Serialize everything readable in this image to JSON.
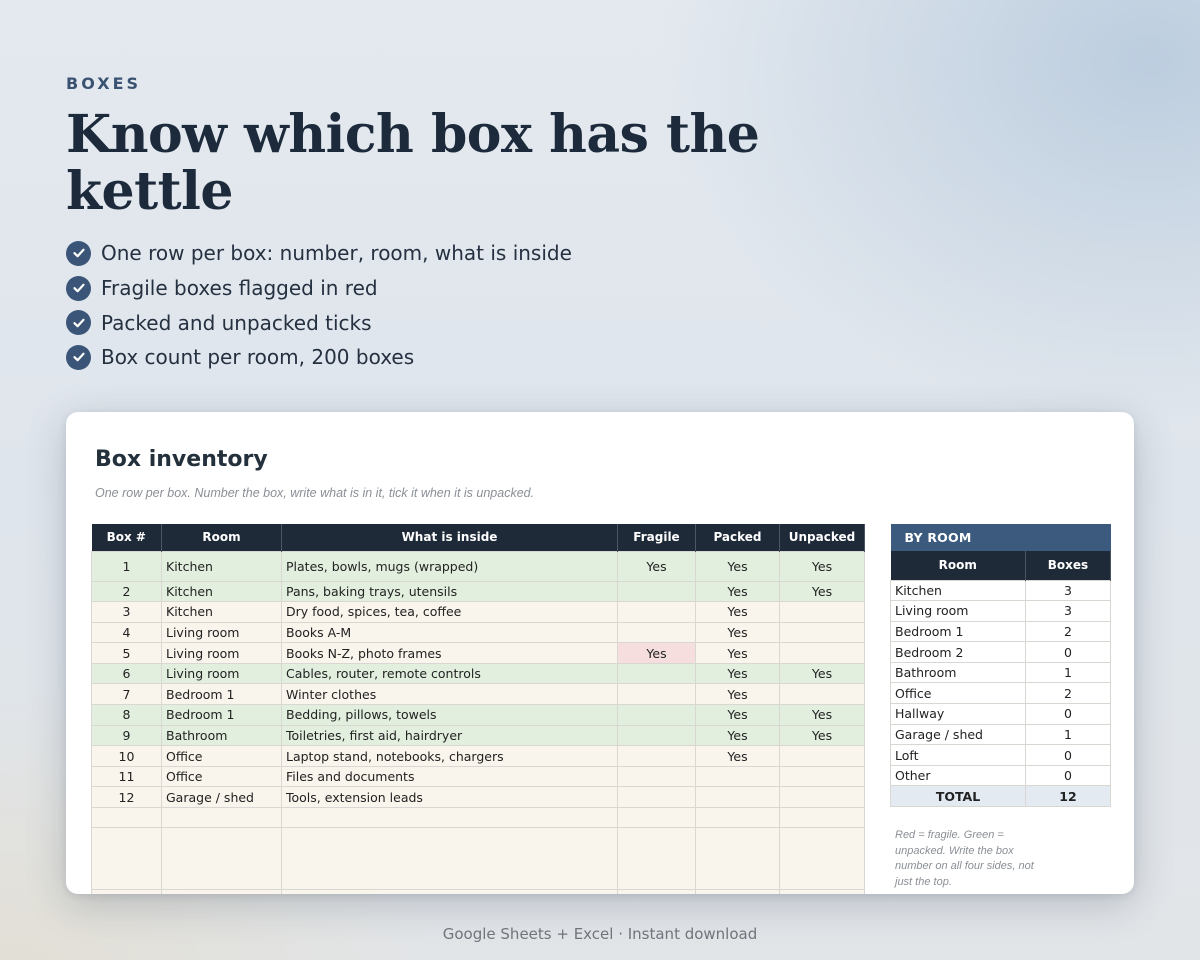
{
  "hero": {
    "eyebrow": "BOXES",
    "headline": "Know which box has the kettle",
    "bullets": [
      "One row per box: number, room, what is inside",
      "Fragile boxes flagged in red",
      "Packed and unpacked ticks",
      "Box count per room, 200 boxes"
    ]
  },
  "sheet": {
    "title": "Box inventory",
    "subtitle": "One row per box. Number the box, write what is in it, tick it when it is unpacked.",
    "columns": [
      "Box #",
      "Room",
      "What is inside",
      "Fragile",
      "Packed",
      "Unpacked"
    ],
    "rows": [
      [
        "1",
        "Kitchen",
        "Plates, bowls, mugs (wrapped)",
        "Yes",
        "Yes",
        "Yes"
      ],
      [
        "2",
        "Kitchen",
        "Pans, baking trays, utensils",
        "",
        "Yes",
        "Yes"
      ],
      [
        "3",
        "Kitchen",
        "Dry food, spices, tea, coffee",
        "",
        "Yes",
        ""
      ],
      [
        "4",
        "Living room",
        "Books A-M",
        "",
        "Yes",
        ""
      ],
      [
        "5",
        "Living room",
        "Books N-Z, photo frames",
        "Yes",
        "Yes",
        ""
      ],
      [
        "6",
        "Living room",
        "Cables, router, remote controls",
        "",
        "Yes",
        "Yes"
      ],
      [
        "7",
        "Bedroom 1",
        "Winter clothes",
        "",
        "Yes",
        ""
      ],
      [
        "8",
        "Bedroom 1",
        "Bedding, pillows, towels",
        "",
        "Yes",
        "Yes"
      ],
      [
        "9",
        "Bathroom",
        "Toiletries, first aid, hairdryer",
        "",
        "Yes",
        "Yes"
      ],
      [
        "10",
        "Office",
        "Laptop stand, notebooks, chargers",
        "",
        "Yes",
        ""
      ],
      [
        "11",
        "Office",
        "Files and documents",
        "",
        "",
        ""
      ],
      [
        "12",
        "Garage / shed",
        "Tools, extension leads",
        "",
        "",
        ""
      ]
    ],
    "colors": {
      "header": "#1e2a38",
      "unpacked_green": "#e2efdf",
      "fragile_red": "#f6dede",
      "cream": "#f9f4ec"
    }
  },
  "by_room": {
    "banner": "BY ROOM",
    "columns": [
      "Room",
      "Boxes"
    ],
    "rows": [
      [
        "Kitchen",
        "3"
      ],
      [
        "Living room",
        "3"
      ],
      [
        "Bedroom 1",
        "2"
      ],
      [
        "Bedroom 2",
        "0"
      ],
      [
        "Bathroom",
        "1"
      ],
      [
        "Office",
        "2"
      ],
      [
        "Hallway",
        "0"
      ],
      [
        "Garage / shed",
        "1"
      ],
      [
        "Loft",
        "0"
      ],
      [
        "Other",
        "0"
      ]
    ],
    "total_label": "TOTAL",
    "total_value": "12",
    "note": "Red = fragile. Green = unpacked. Write the box number on all four sides, not just the top."
  },
  "footer": "Google Sheets + Excel  ·  Instant download"
}
